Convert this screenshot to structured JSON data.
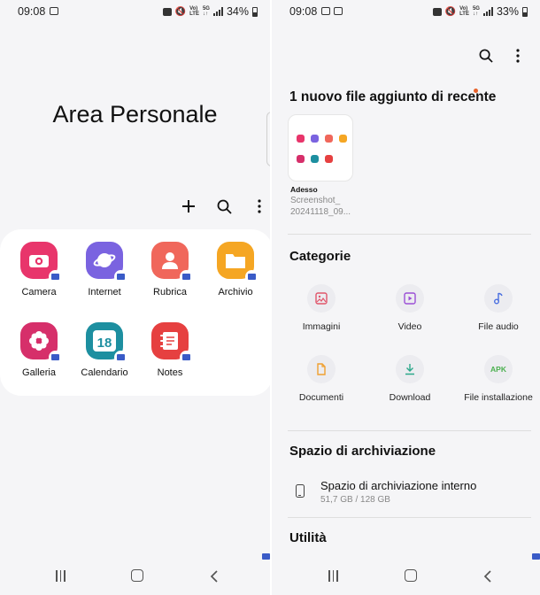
{
  "left": {
    "status": {
      "time": "09:08",
      "battery": "34%"
    },
    "title": "Area Personale",
    "apps": [
      {
        "label": "Camera",
        "color": "#e8356b",
        "icon": "camera-icon"
      },
      {
        "label": "Internet",
        "color": "#7a63e0",
        "icon": "internet-icon"
      },
      {
        "label": "Rubrica",
        "color": "#f0675b",
        "icon": "contacts-icon"
      },
      {
        "label": "Archivio",
        "color": "#f5a623",
        "icon": "folder-icon"
      },
      {
        "label": "Galleria",
        "color": "#d62f6a",
        "icon": "gallery-icon"
      },
      {
        "label": "Calendario",
        "color": "#1d8fa0",
        "icon": "calendar-icon",
        "date": "18"
      },
      {
        "label": "Notes",
        "color": "#e64040",
        "icon": "notes-icon"
      }
    ]
  },
  "right": {
    "status": {
      "time": "09:08",
      "battery": "33%"
    },
    "recent_title": "1 nuovo file aggiunto di recente",
    "recent_file": {
      "when": "Adesso",
      "name_line1": "Screenshot_",
      "name_line2": "20241118_09..."
    },
    "categories_title": "Categorie",
    "categories": [
      {
        "label": "Immagini",
        "icon": "image-icon",
        "color": "#e0566b"
      },
      {
        "label": "Video",
        "icon": "video-icon",
        "color": "#9b4fd6"
      },
      {
        "label": "File audio",
        "icon": "audio-icon",
        "color": "#4a6fe0"
      },
      {
        "label": "Documenti",
        "icon": "document-icon",
        "color": "#f0a030"
      },
      {
        "label": "Download",
        "icon": "download-icon",
        "color": "#2ba88a"
      },
      {
        "label": "File installazione",
        "icon": "apk-icon",
        "color": "#4cb050",
        "text": "APK"
      }
    ],
    "storage_title": "Spazio di archiviazione",
    "storage": {
      "label": "Spazio di archiviazione interno",
      "usage": "51,7 GB / 128 GB"
    },
    "utility_title": "Utilità"
  }
}
